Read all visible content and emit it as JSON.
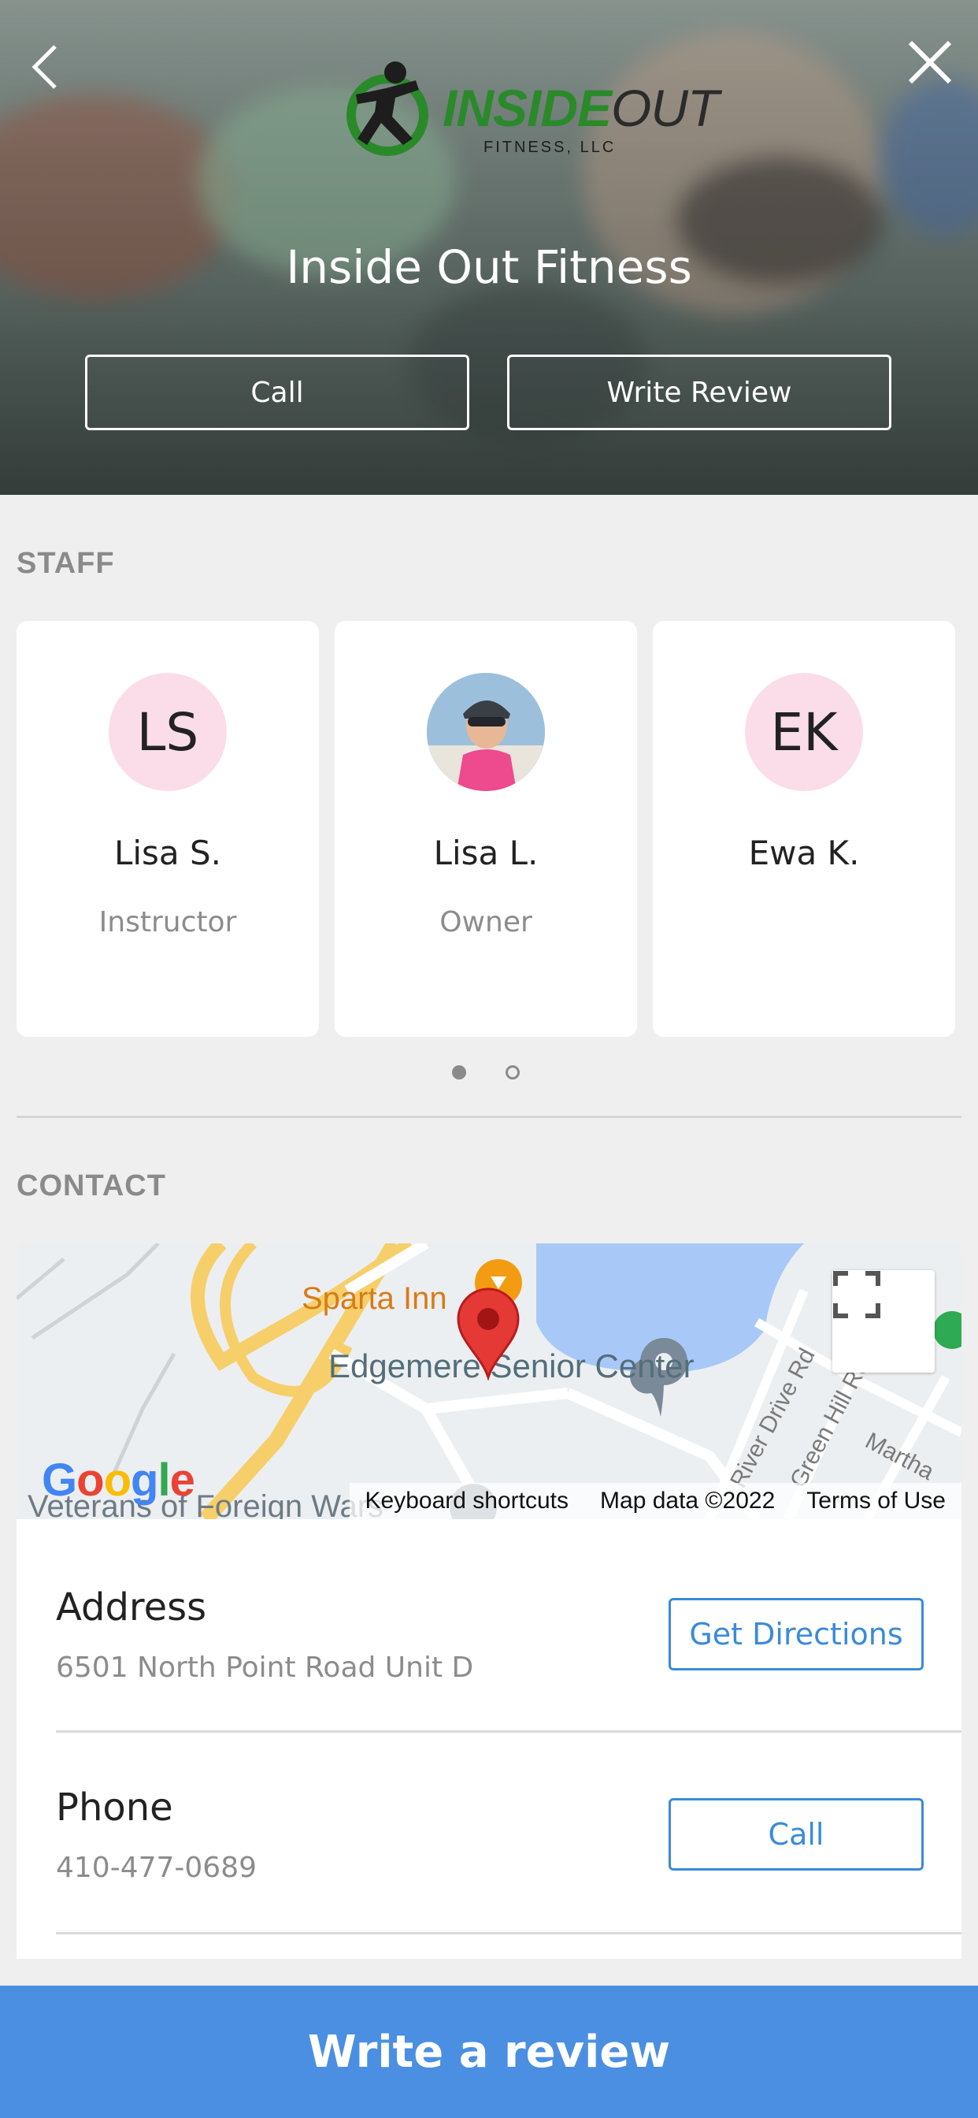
{
  "hero": {
    "logo_text_1": "INSIDE",
    "logo_text_2": "OUT",
    "logo_sub": "FITNESS, LLC",
    "title": "Inside Out Fitness",
    "call_label": "Call",
    "review_label": "Write Review"
  },
  "staff": {
    "heading": "STAFF",
    "members": [
      {
        "initials": "LS",
        "name": "Lisa S.",
        "role": "Instructor"
      },
      {
        "initials": "",
        "name": "Lisa L.",
        "role": "Owner"
      },
      {
        "initials": "EK",
        "name": "Ewa K.",
        "role": ""
      }
    ],
    "page_count": 2,
    "current_page": 1
  },
  "contact": {
    "heading": "CONTACT",
    "map": {
      "place_1": "Sparta Inn",
      "place_2": "Edgemere Senior Center",
      "road_1": "River Drive Rd",
      "road_2": "Green Hill Rd",
      "road_3": "Martha",
      "place_3": "Veterans of Foreign Wars",
      "google": "Google",
      "keyboard": "Keyboard shortcuts",
      "mapdata": "Map data ©2022",
      "terms": "Terms of Use"
    },
    "address": {
      "label": "Address",
      "value": "6501 North Point Road Unit D",
      "button": "Get Directions"
    },
    "phone": {
      "label": "Phone",
      "value": "410-477-0689",
      "button": "Call"
    }
  },
  "cta": {
    "label": "Write a review"
  },
  "colors": {
    "accent": "#4a8fe2",
    "link": "#3a8bd9",
    "avatar_bg": "#fbdde9",
    "logo_green": "#2a8a2a"
  }
}
